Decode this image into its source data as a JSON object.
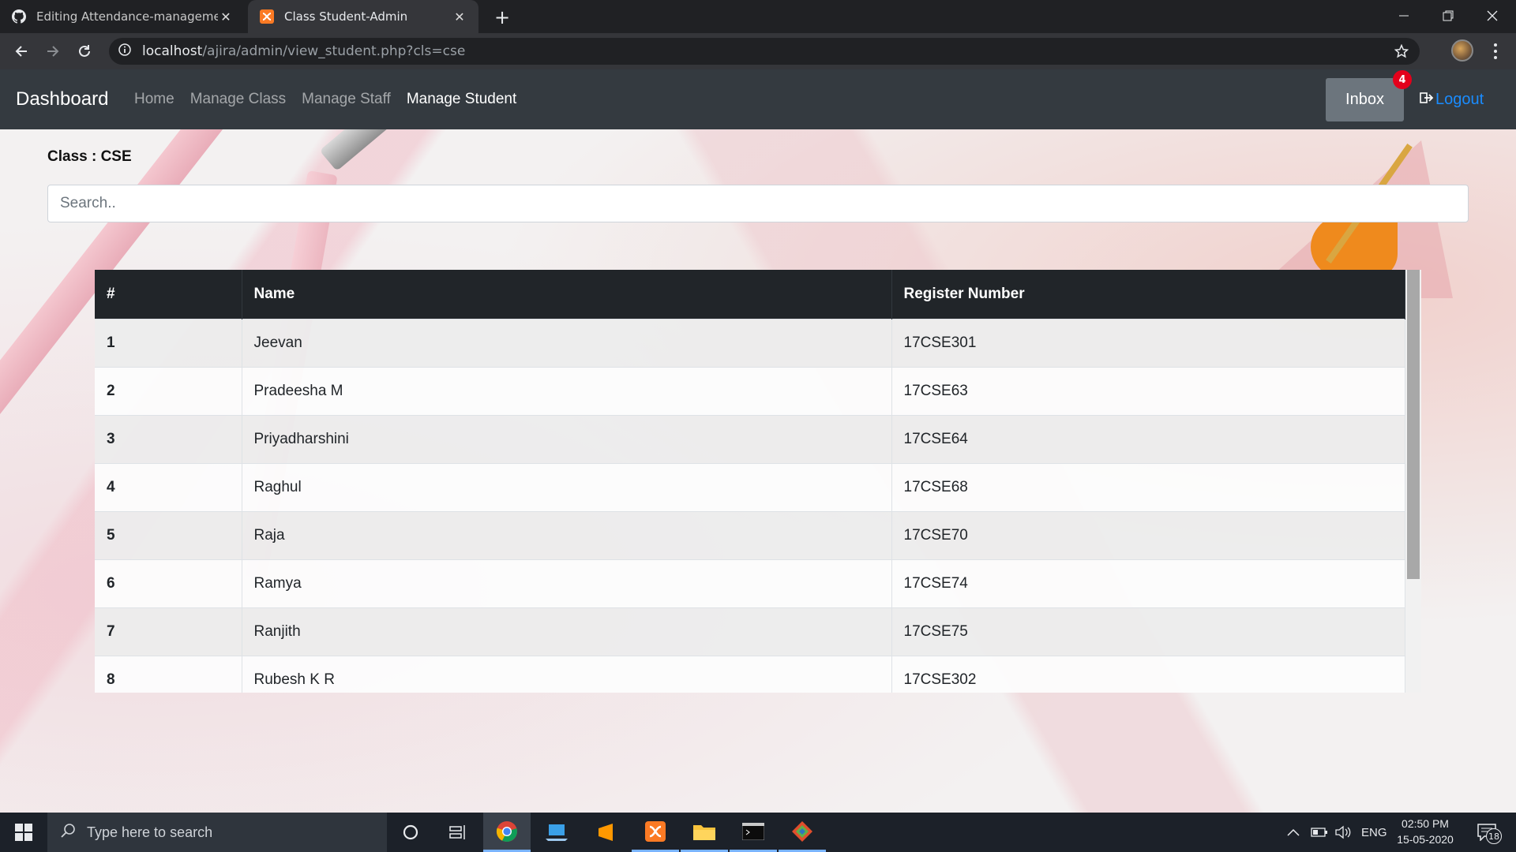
{
  "browser": {
    "tabs": [
      {
        "title": "Editing Attendance-management",
        "icon": "github-icon",
        "active": false
      },
      {
        "title": "Class Student-Admin",
        "icon": "xampp-icon",
        "active": true
      }
    ],
    "url_host": "localhost",
    "url_path": "/ajira/admin/view_student.php?cls=cse"
  },
  "navbar": {
    "brand": "Dashboard",
    "links": [
      "Home",
      "Manage Class",
      "Manage Staff",
      "Manage Student"
    ],
    "active_link": "Manage Student",
    "inbox_label": "Inbox",
    "inbox_count": "4",
    "logout_label": "Logout"
  },
  "page": {
    "class_label": "Class : CSE",
    "search_placeholder": "Search.."
  },
  "table": {
    "headers": [
      "#",
      "Name",
      "Register Number"
    ],
    "rows": [
      {
        "num": "1",
        "name": "Jeevan",
        "reg": "17CSE301"
      },
      {
        "num": "2",
        "name": "Pradeesha M",
        "reg": "17CSE63"
      },
      {
        "num": "3",
        "name": "Priyadharshini",
        "reg": "17CSE64"
      },
      {
        "num": "4",
        "name": "Raghul",
        "reg": "17CSE68"
      },
      {
        "num": "5",
        "name": "Raja",
        "reg": "17CSE70"
      },
      {
        "num": "6",
        "name": "Ramya",
        "reg": "17CSE74"
      },
      {
        "num": "7",
        "name": "Ranjith",
        "reg": "17CSE75"
      },
      {
        "num": "8",
        "name": "Rubesh K R",
        "reg": "17CSE302"
      }
    ]
  },
  "taskbar": {
    "search_placeholder": "Type here to search",
    "language": "ENG",
    "time": "02:50 PM",
    "date": "15-05-2020",
    "notification_count": "18"
  },
  "colors": {
    "navbar_bg": "#343a40",
    "table_header_bg": "#212529",
    "badge": "#e3001b",
    "logout_link": "#1a8cff"
  }
}
